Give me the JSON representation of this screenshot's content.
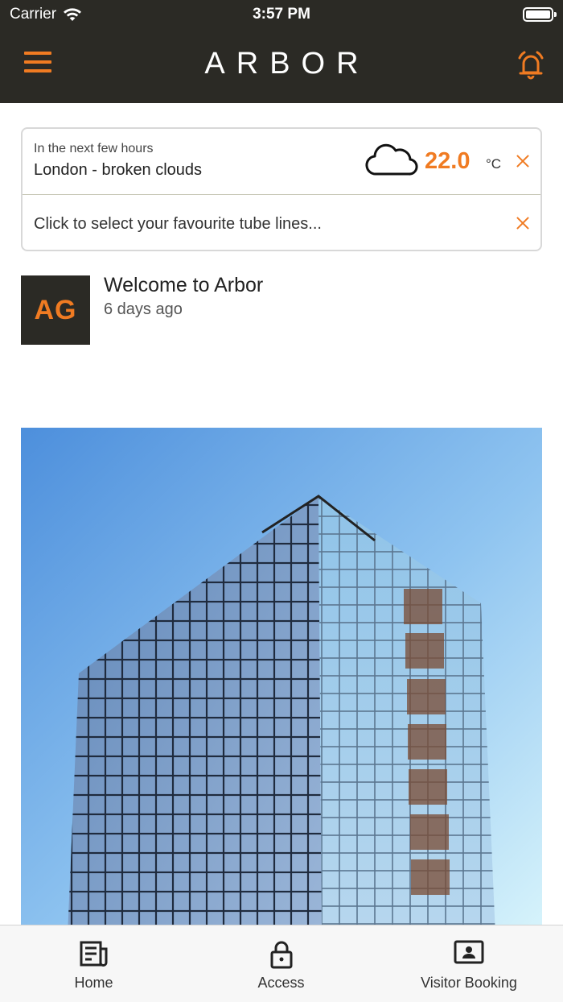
{
  "status": {
    "carrier": "Carrier",
    "time": "3:57 PM"
  },
  "header": {
    "brand": "ARBOR",
    "accent": "#f07b22",
    "background": "#2b2a25"
  },
  "weather": {
    "subtitle": "In the next few hours",
    "location": "London -",
    "condition": "broken clouds",
    "temperature": "22.0",
    "unit": "°C",
    "icon": "cloud-icon"
  },
  "tube": {
    "prompt": "Click to select your favourite tube lines..."
  },
  "feed": [
    {
      "avatar_initials": "AG",
      "title": "Welcome to Arbor",
      "time": "6 days ago"
    }
  ],
  "tabs": [
    {
      "label": "Home",
      "icon": "newspaper-icon"
    },
    {
      "label": "Access",
      "icon": "lock-icon"
    },
    {
      "label": "Visitor Booking",
      "icon": "id-card-icon"
    }
  ]
}
